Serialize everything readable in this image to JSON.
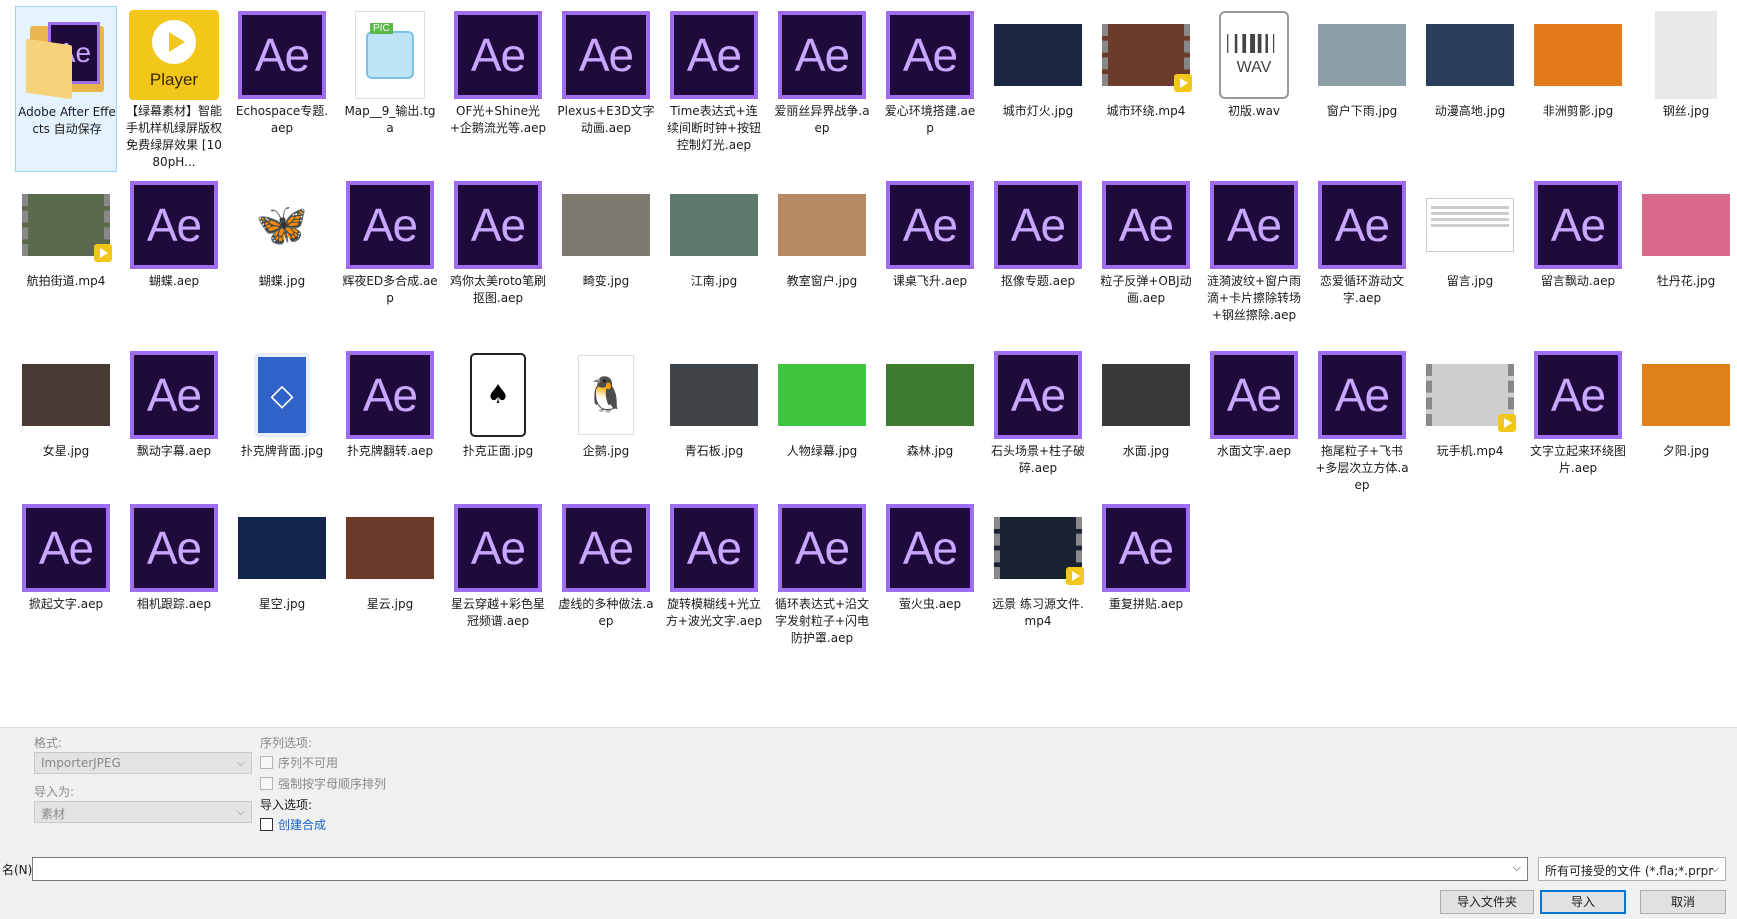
{
  "items": [
    {
      "label": "Adobe After Effects 自动保存",
      "icon": "folder"
    },
    {
      "label": "【绿幕素材】智能手机样机绿屏版权免费绿屏效果 [1080pH...",
      "icon": "player"
    },
    {
      "label": "Echospace专题.aep",
      "icon": "ae"
    },
    {
      "label": "Map__9_输出.tga",
      "icon": "tga"
    },
    {
      "label": "OF光+Shine光+企鹅流光等.aep",
      "icon": "ae"
    },
    {
      "label": "Plexus+E3D文字动画.aep",
      "icon": "ae"
    },
    {
      "label": "Time表达式+连续间断时钟+按钮控制灯光.aep",
      "icon": "ae"
    },
    {
      "label": "爱丽丝异界战争.aep",
      "icon": "ae"
    },
    {
      "label": "爱心环境搭建.aep",
      "icon": "ae"
    },
    {
      "label": "城市灯火.jpg",
      "icon": "image",
      "color": "#1b2740"
    },
    {
      "label": "城市环绕.mp4",
      "icon": "video",
      "color": "#6c3b2a"
    },
    {
      "label": "初版.wav",
      "icon": "wav"
    },
    {
      "label": "窗户下雨.jpg",
      "icon": "image",
      "color": "#8aa0a6"
    },
    {
      "label": "动漫高地.jpg",
      "icon": "image",
      "color": "#2b3e5a"
    },
    {
      "label": "非洲剪影.jpg",
      "icon": "image",
      "color": "#e07a1a"
    },
    {
      "label": "钢丝.jpg",
      "icon": "image-tall",
      "color": "#e8e8e8"
    },
    {
      "label": "航拍街道.mp4",
      "icon": "video",
      "color": "#5a6a4a"
    },
    {
      "label": "蝴蝶.aep",
      "icon": "ae"
    },
    {
      "label": "蝴蝶.jpg",
      "icon": "butterfly"
    },
    {
      "label": "辉夜ED多合成.aep",
      "icon": "ae"
    },
    {
      "label": "鸡你太美roto笔刷抠图.aep",
      "icon": "ae"
    },
    {
      "label": "畸变.jpg",
      "icon": "image",
      "color": "#7e7a70"
    },
    {
      "label": "江南.jpg",
      "icon": "image",
      "color": "#5e7a6a"
    },
    {
      "label": "教室窗户.jpg",
      "icon": "image",
      "color": "#b58a62"
    },
    {
      "label": "课桌飞升.aep",
      "icon": "ae"
    },
    {
      "label": "抠像专题.aep",
      "icon": "ae"
    },
    {
      "label": "粒子反弹+OBJ动画.aep",
      "icon": "ae"
    },
    {
      "label": "涟漪波纹+窗户雨滴+卡片擦除转场+钢丝擦除.aep",
      "icon": "ae"
    },
    {
      "label": "恋爱循环游动文字.aep",
      "icon": "ae"
    },
    {
      "label": "留言.jpg",
      "icon": "doc"
    },
    {
      "label": "留言飘动.aep",
      "icon": "ae"
    },
    {
      "label": "牡丹花.jpg",
      "icon": "image",
      "color": "#d76a8a"
    },
    {
      "label": "女星.jpg",
      "icon": "image",
      "color": "#4a3a35"
    },
    {
      "label": "飘动字幕.aep",
      "icon": "ae"
    },
    {
      "label": "扑克牌背面.jpg",
      "icon": "card-back"
    },
    {
      "label": "扑克牌翻转.aep",
      "icon": "ae"
    },
    {
      "label": "扑克正面.jpg",
      "icon": "card"
    },
    {
      "label": "企鹅.jpg",
      "icon": "penguin"
    },
    {
      "label": "青石板.jpg",
      "icon": "image",
      "color": "#3e4448"
    },
    {
      "label": "人物绿幕.jpg",
      "icon": "image",
      "color": "#3ec43e"
    },
    {
      "label": "森林.jpg",
      "icon": "image",
      "color": "#3d7a2e"
    },
    {
      "label": "石头场景+柱子破碎.aep",
      "icon": "ae"
    },
    {
      "label": "水面.jpg",
      "icon": "image",
      "color": "#3a3a3a"
    },
    {
      "label": "水面文字.aep",
      "icon": "ae"
    },
    {
      "label": "拖尾粒子+飞书+多层次立方体.aep",
      "icon": "ae"
    },
    {
      "label": "玩手机.mp4",
      "icon": "video",
      "color": "#cfcfcf"
    },
    {
      "label": "文字立起来环绕图片.aep",
      "icon": "ae"
    },
    {
      "label": "夕阳.jpg",
      "icon": "image",
      "color": "#e0801a"
    },
    {
      "label": "掀起文字.aep",
      "icon": "ae"
    },
    {
      "label": "相机跟踪.aep",
      "icon": "ae"
    },
    {
      "label": "星空.jpg",
      "icon": "image",
      "color": "#13254a"
    },
    {
      "label": "星云.jpg",
      "icon": "image",
      "color": "#6a3a2a"
    },
    {
      "label": "星云穿越+彩色星冠频谱.aep",
      "icon": "ae"
    },
    {
      "label": "虚线的多种做法.aep",
      "icon": "ae"
    },
    {
      "label": "旋转模糊线+光立方+波光文字.aep",
      "icon": "ae"
    },
    {
      "label": "循环表达式+沿文字发射粒子+闪电防护罩.aep",
      "icon": "ae"
    },
    {
      "label": "萤火虫.aep",
      "icon": "ae"
    },
    {
      "label": "远景 练习源文件.mp4",
      "icon": "video",
      "color": "#1a2232"
    },
    {
      "label": "重复拼贴.aep",
      "icon": "ae"
    }
  ],
  "icon_text": {
    "ae": "Ae",
    "player": "Player",
    "wav": "WAV",
    "pic": "PIC"
  },
  "panel": {
    "format_label": "格式:",
    "format_value": "ImporterJPEG",
    "import_as_label": "导入为:",
    "import_as_value": "素材",
    "sequence_label": "序列选项:",
    "sequence_unavailable": "序列不可用",
    "force_alpha": "强制按字母顺序排列",
    "import_options_label": "导入选项:",
    "create_comp": "创建合成",
    "filename_label": "名(N):",
    "filename_value": "",
    "filter_value": "所有可接受的文件 (*.fla;*.prpr",
    "import_folder_btn": "导入文件夹",
    "import_btn": "导入",
    "cancel_btn": "取消"
  },
  "colors": {
    "ae_border": "#9f6df0",
    "ae_fill": "#1f0a3c",
    "accent": "#0078d7",
    "player": "#f2c71a"
  }
}
